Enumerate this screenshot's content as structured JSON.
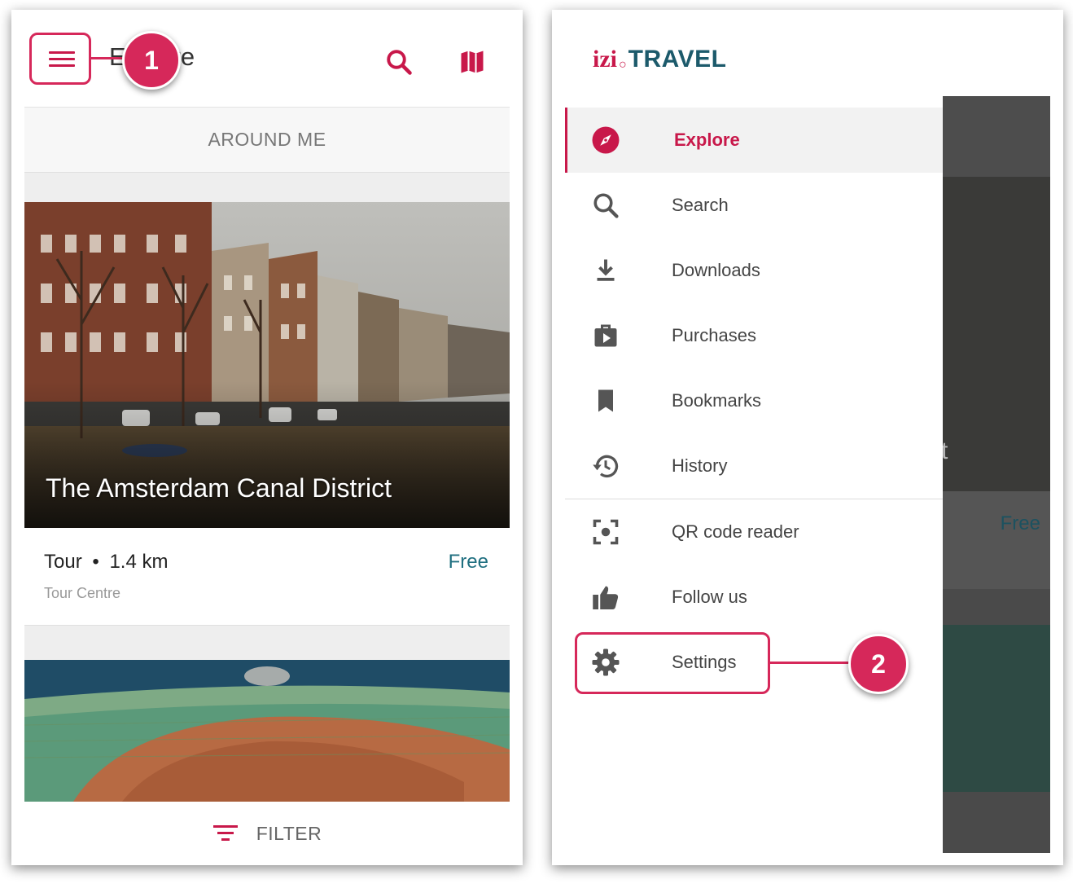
{
  "left": {
    "title": "Explore",
    "around_me": "AROUND ME",
    "card": {
      "title": "The Amsterdam Canal District",
      "type": "Tour",
      "dot": "•",
      "distance": "1.4 km",
      "price": "Free",
      "place": "Tour Centre"
    },
    "filter_label": "FILTER",
    "callout_number": "1"
  },
  "right": {
    "logo": {
      "izi": "izi",
      "dot": "○",
      "travel": "TRAVEL"
    },
    "menu": [
      {
        "label": "Explore",
        "icon": "compass-icon",
        "active": true
      },
      {
        "label": "Search",
        "icon": "search-icon"
      },
      {
        "label": "Downloads",
        "icon": "download-icon"
      },
      {
        "label": "Purchases",
        "icon": "purchases-icon"
      },
      {
        "label": "Bookmarks",
        "icon": "bookmark-icon"
      },
      {
        "label": "History",
        "icon": "history-icon"
      },
      {
        "label": "QR code reader",
        "icon": "qr-icon"
      },
      {
        "label": "Follow us",
        "icon": "thumbs-up-icon"
      },
      {
        "label": "Settings",
        "icon": "gear-icon"
      }
    ],
    "scrim_price": "Free",
    "scrim_fragment": "t",
    "callout_number": "2"
  },
  "colors": {
    "accent": "#c8184a",
    "callout": "#d6285a",
    "teal": "#1c5a6b",
    "price": "#1f6f80"
  }
}
